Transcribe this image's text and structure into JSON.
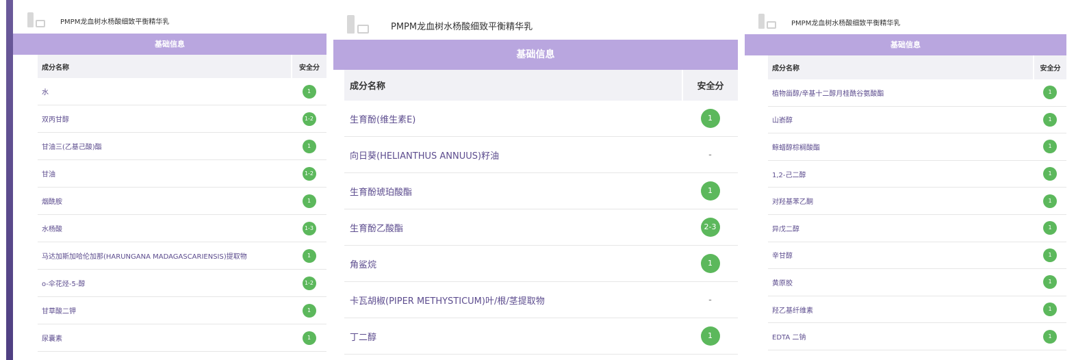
{
  "product_title": "PMPM龙血树水杨酸细致平衡精华乳",
  "section_label": "基础信息",
  "col_name": "成分名称",
  "col_score": "安全分",
  "colors": {
    "accent_bar": "#b9a6df",
    "badge_green": "#5cb85c",
    "side_bar": "#5a4a8c"
  },
  "panel1": {
    "rows": [
      {
        "name": "水",
        "score": "1"
      },
      {
        "name": "双丙甘醇",
        "score": "1-2"
      },
      {
        "name": "甘油三(乙基己酸)酯",
        "score": "1"
      },
      {
        "name": "甘油",
        "score": "1-2"
      },
      {
        "name": "烟酰胺",
        "score": "1"
      },
      {
        "name": "水杨酸",
        "score": "1-3"
      },
      {
        "name": "马达加斯加哈伦加那(HARUNGANA MADAGASCARIENSIS)提取物",
        "score": "1"
      },
      {
        "name": "o-伞花烃-5-醇",
        "score": "1-2"
      },
      {
        "name": "甘草酸二钾",
        "score": "1"
      },
      {
        "name": "尿囊素",
        "score": "1"
      }
    ]
  },
  "panel2": {
    "rows": [
      {
        "name": "生育酚(维生素E)",
        "score": "1"
      },
      {
        "name": "向日葵(HELIANTHUS ANNUUS)籽油",
        "score": "-"
      },
      {
        "name": "生育酚琥珀酸酯",
        "score": "1"
      },
      {
        "name": "生育酚乙酸酯",
        "score": "2-3"
      },
      {
        "name": "角鲨烷",
        "score": "1"
      },
      {
        "name": "卡瓦胡椒(PIPER METHYSTICUM)叶/根/茎提取物",
        "score": "-"
      },
      {
        "name": "丁二醇",
        "score": "1"
      }
    ]
  },
  "panel3": {
    "rows": [
      {
        "name": "植物甾醇/辛基十二醇月桂酰谷氨酸酯",
        "score": "1"
      },
      {
        "name": "山嵛醇",
        "score": "1"
      },
      {
        "name": "鲸蜡醇棕榈酸酯",
        "score": "1"
      },
      {
        "name": "1,2-己二醇",
        "score": "1"
      },
      {
        "name": "对羟基苯乙酮",
        "score": "1"
      },
      {
        "name": "异戊二醇",
        "score": "1"
      },
      {
        "name": "辛甘醇",
        "score": "1"
      },
      {
        "name": "黄原胶",
        "score": "1"
      },
      {
        "name": "羟乙基纤维素",
        "score": "1"
      },
      {
        "name": "EDTA 二钠",
        "score": "1"
      }
    ]
  }
}
